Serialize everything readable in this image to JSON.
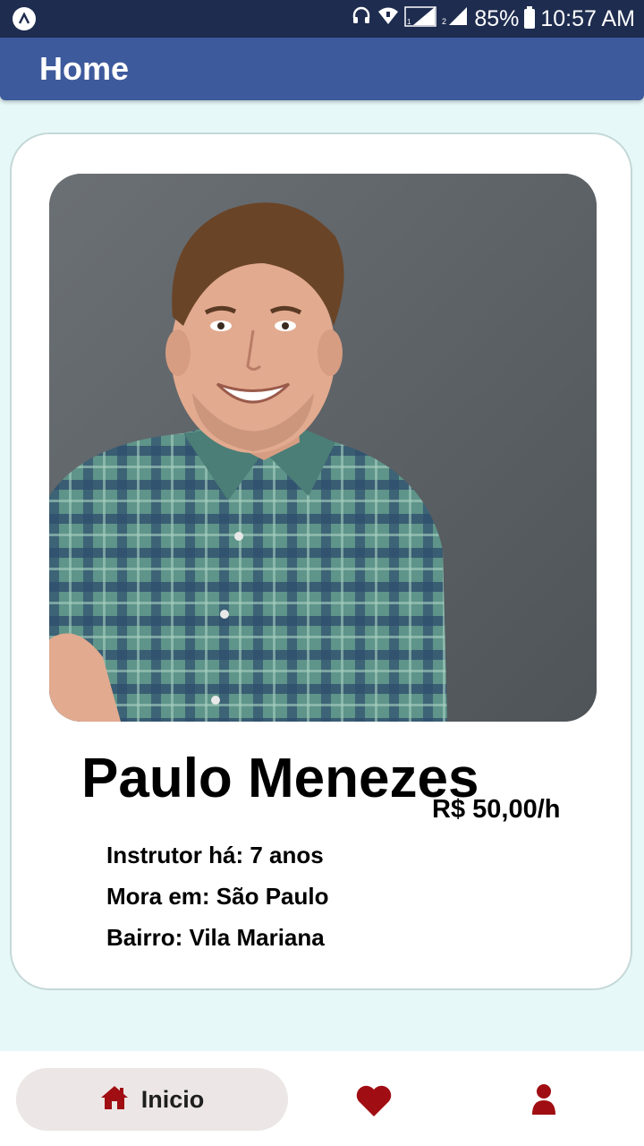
{
  "status_bar": {
    "battery": "85%",
    "time": "10:57 AM",
    "icons": [
      "app-logo-icon",
      "headset-icon",
      "wifi-icon",
      "sim1-signal-icon",
      "sim2-signal-icon",
      "battery-icon"
    ]
  },
  "app_bar": {
    "title": "Home"
  },
  "profile": {
    "photo_description": "Portrait photo of smiling man in plaid shirt",
    "name": "Paulo Menezes",
    "price": "R$ 50,00/h",
    "details": [
      "Instrutor há: 7 anos",
      "Mora em: São Paulo",
      "Bairro: Vila Mariana"
    ]
  },
  "bottom_nav": {
    "tabs": [
      {
        "label": "Inicio",
        "icon": "home-icon",
        "active": true
      },
      {
        "label": "",
        "icon": "heart-icon",
        "active": false
      },
      {
        "label": "",
        "icon": "user-icon",
        "active": false
      }
    ]
  },
  "colors": {
    "status_bar": "#1e2c4f",
    "app_bar": "#3d5a9c",
    "background": "#e6f8f8",
    "nav_icon": "#a00d12",
    "active_tab_bg": "#ece6e6"
  }
}
